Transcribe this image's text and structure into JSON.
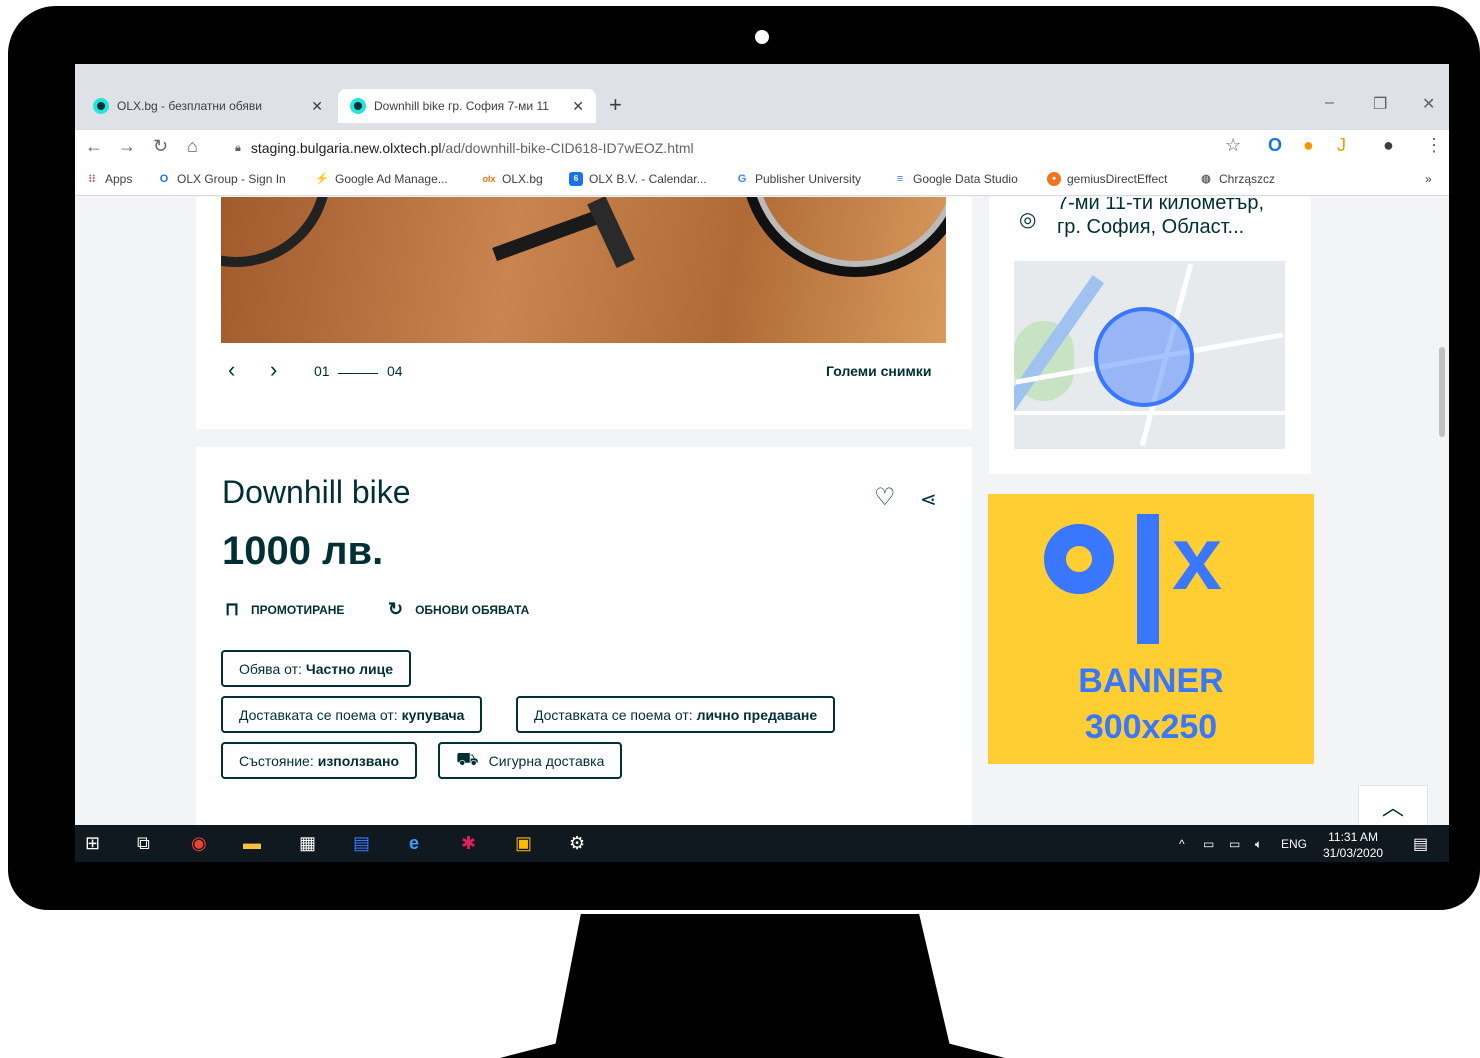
{
  "browser": {
    "tabs": [
      {
        "title": "OLX.bg - безплатни обяви",
        "active": false
      },
      {
        "title": "Downhill bike гр. София 7-ми 11",
        "active": true
      }
    ],
    "new_tab_label": "+",
    "window_controls": {
      "minimize": "–",
      "restore": "❐",
      "close": "✕"
    },
    "url_host": "staging.bulgaria.new.olxtech.pl",
    "url_path": "/ad/downhill-bike-CID618-ID7wEOZ.html",
    "bookmarks": [
      {
        "label": "Apps",
        "icon": "apps-grid-icon"
      },
      {
        "label": "OLX Group - Sign In",
        "icon": "olx-group-icon"
      },
      {
        "label": "Google Ad Manage...",
        "icon": "ad-manager-icon"
      },
      {
        "label": "OLX.bg",
        "icon": "olx-icon"
      },
      {
        "label": "OLX B.V. - Calendar...",
        "icon": "calendar-icon"
      },
      {
        "label": "Publisher University",
        "icon": "google-icon"
      },
      {
        "label": "Google Data Studio",
        "icon": "data-studio-icon"
      },
      {
        "label": "gemiusDirectEffect",
        "icon": "gemius-icon"
      },
      {
        "label": "Chrząszcz",
        "icon": "globe-icon"
      }
    ],
    "bookmarks_more": "»"
  },
  "gallery": {
    "current": "01",
    "total": "04",
    "big_pics_label": "Големи снимки"
  },
  "ad": {
    "title": "Downhill bike",
    "price": "1000 лв.",
    "promote_label": "Промотиране",
    "refresh_label": "Обнови обявата",
    "chips": [
      {
        "label": "Обява от:",
        "value": "Частно лице"
      },
      {
        "label": "Доставката се поема от:",
        "value": "купувача"
      },
      {
        "label": "Доставката се поема от:",
        "value": "лично предаване"
      },
      {
        "label": "Състояние:",
        "value": "използвано"
      },
      {
        "label": "Сигурна доставка",
        "value": ""
      }
    ]
  },
  "location": {
    "line1": "7-ми 11-ти километър,",
    "line2": "гр. София, Област..."
  },
  "banner": {
    "line1": "BANNER",
    "line2": "300x250",
    "color": "#ffce32",
    "logo_color": "#3a77ff"
  },
  "taskbar": {
    "language": "ENG",
    "time": "11:31 AM",
    "date": "31/03/2020"
  },
  "colors": {
    "olx_dark": "#002f34",
    "olx_teal": "#23e5db"
  }
}
